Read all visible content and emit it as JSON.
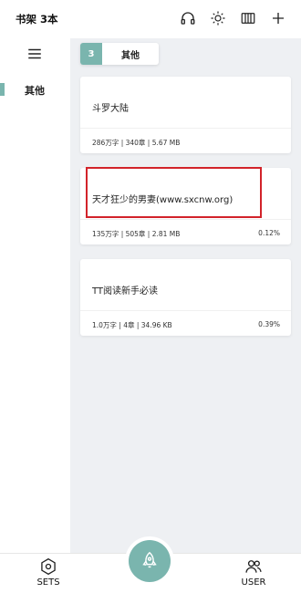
{
  "header": {
    "title": "书架 3本",
    "icons": [
      "headphones-icon",
      "brightness-icon",
      "bookshelf-icon",
      "add-icon"
    ]
  },
  "sidebar": {
    "menu_icon": "menu-icon",
    "items": [
      {
        "label": "其他",
        "selected": true
      }
    ]
  },
  "group_tab": {
    "count": "3",
    "label": "其他"
  },
  "books": [
    {
      "title": "斗罗大陆",
      "meta": "286万字 | 340章 | 5.67 MB",
      "progress": ""
    },
    {
      "title": "天才狂少的男妻(www.sxcnw.org)",
      "meta": "135万字 | 505章 | 2.81 MB",
      "progress": "0.12%"
    },
    {
      "title": "TT阅读新手必读",
      "meta": "1.0万字 | 4章 | 34.96 KB",
      "progress": "0.39%"
    }
  ],
  "bottom_nav": {
    "sets_label": "SETS",
    "user_label": "USER"
  },
  "colors": {
    "accent": "#7ab5ae",
    "highlight": "#d2232a",
    "content_bg": "#eef0f3"
  }
}
